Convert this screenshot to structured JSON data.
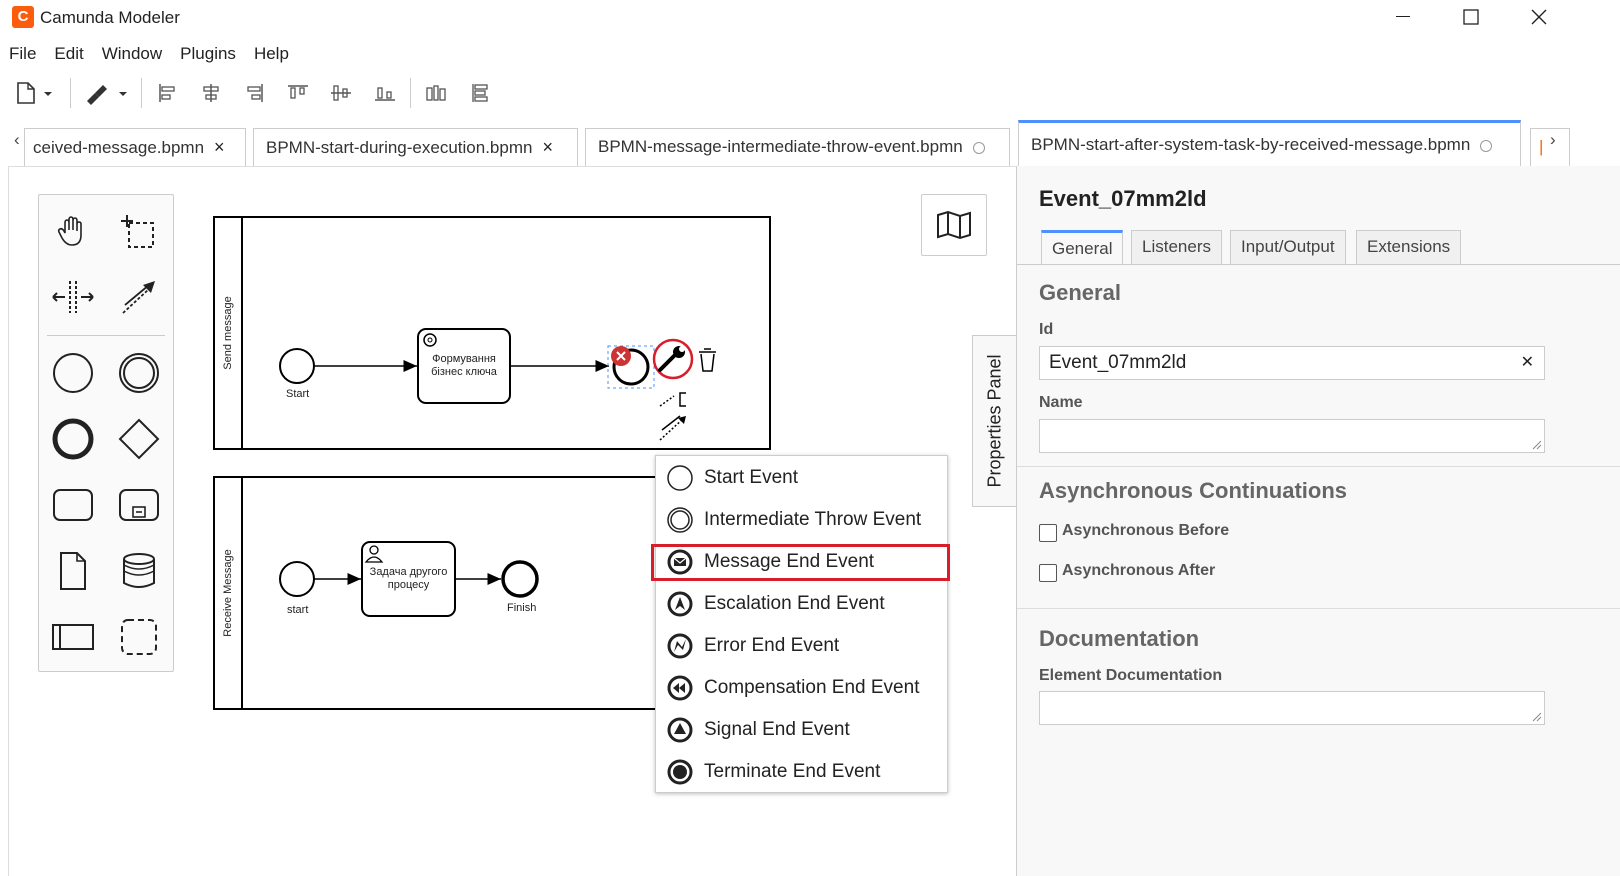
{
  "window": {
    "title": "Camunda Modeler",
    "logo_letter": "C"
  },
  "menu": [
    "File",
    "Edit",
    "Window",
    "Plugins",
    "Help"
  ],
  "tabs": [
    {
      "label": "ceived-message.bpmn",
      "state": "close"
    },
    {
      "label": "BPMN-start-during-execution.bpmn",
      "state": "close"
    },
    {
      "label": "BPMN-message-intermediate-throw-event.bpmn",
      "state": "unsaved"
    },
    {
      "label": "BPMN-start-after-system-task-by-received-message.bpmn",
      "state": "active"
    }
  ],
  "diagram": {
    "pool1_label": "Send message",
    "pool2_label": "Receive Message",
    "start1_label": "Start",
    "task1_label_line1": "Формування",
    "task1_label_line2": "бізнес ключа",
    "start2_label": "start",
    "task2_label_line1": "Задача другого",
    "task2_label_line2": "процесу",
    "finish_label": "Finish"
  },
  "popup": {
    "items": [
      {
        "label": "Start Event",
        "icon": "start-event-icon"
      },
      {
        "label": "Intermediate Throw Event",
        "icon": "intermediate-throw-event-icon"
      },
      {
        "label": "Message End Event",
        "icon": "message-end-event-icon"
      },
      {
        "label": "Escalation End Event",
        "icon": "escalation-end-event-icon"
      },
      {
        "label": "Error End Event",
        "icon": "error-end-event-icon"
      },
      {
        "label": "Compensation End Event",
        "icon": "compensation-end-event-icon"
      },
      {
        "label": "Signal End Event",
        "icon": "signal-end-event-icon"
      },
      {
        "label": "Terminate End Event",
        "icon": "terminate-end-event-icon"
      }
    ],
    "highlighted": "Message End Event"
  },
  "properties": {
    "toggle_label": "Properties Panel",
    "title": "Event_07mm2ld",
    "tabs": [
      "General",
      "Listeners",
      "Input/Output",
      "Extensions"
    ],
    "active_tab": "General",
    "general_title": "General",
    "id_label": "Id",
    "id_value": "Event_07mm2ld",
    "name_label": "Name",
    "name_value": "",
    "async_title": "Asynchronous Continuations",
    "async_before": "Asynchronous Before",
    "async_after": "Asynchronous After",
    "doc_title": "Documentation",
    "doc_label": "Element Documentation"
  },
  "colors": {
    "accent": "#4d90fe",
    "highlight": "#d81e2b",
    "logo": "#fc5d0d",
    "error": "#cc3333"
  }
}
